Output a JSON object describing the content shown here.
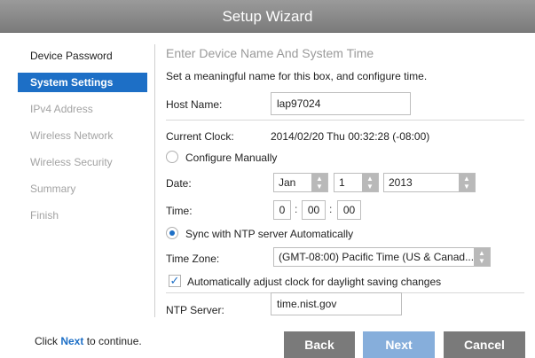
{
  "window": {
    "title": "Setup Wizard"
  },
  "sidebar": {
    "items": [
      {
        "label": "Device Password",
        "state": "done"
      },
      {
        "label": "System Settings",
        "state": "active"
      },
      {
        "label": "IPv4 Address",
        "state": "pending"
      },
      {
        "label": "Wireless Network",
        "state": "pending"
      },
      {
        "label": "Wireless Security",
        "state": "pending"
      },
      {
        "label": "Summary",
        "state": "pending"
      },
      {
        "label": "Finish",
        "state": "pending"
      }
    ]
  },
  "main": {
    "heading": "Enter Device Name And System Time",
    "description": "Set a meaningful name for this box, and configure time.",
    "host_name": {
      "label": "Host Name:",
      "value": "lap97024"
    },
    "current_clock": {
      "label": "Current Clock:",
      "value": "2014/02/20 Thu 00:32:28 (-08:00)"
    },
    "manual": {
      "label": "Configure Manually",
      "selected": false,
      "date_label": "Date:",
      "month": "Jan",
      "day": "1",
      "year": "2013",
      "time_label": "Time:",
      "hour": "0",
      "minute": "00",
      "second": "00"
    },
    "ntp": {
      "label": "Sync with NTP server Automatically",
      "selected": true,
      "timezone_label": "Time Zone:",
      "timezone_value": "(GMT-08:00) Pacific Time (US & Canad...",
      "dst_label": "Automatically adjust clock for daylight saving changes",
      "dst_checked": true,
      "server_label": "NTP Server:",
      "server_value": "time.nist.gov"
    }
  },
  "footer": {
    "hint_prefix": "Click ",
    "hint_link": "Next",
    "hint_suffix": " to continue.",
    "back_label": "Back",
    "next_label": "Next",
    "cancel_label": "Cancel"
  },
  "colors": {
    "accent": "#1d6fc6",
    "button": "#7a7a7a",
    "button_disabled": "#86aedb",
    "titlebar": "#8a8a8a"
  },
  "icons": {
    "spinner": "up-down-arrows-icon",
    "radio": "radio-icon",
    "checkbox": "checkmark-icon"
  }
}
